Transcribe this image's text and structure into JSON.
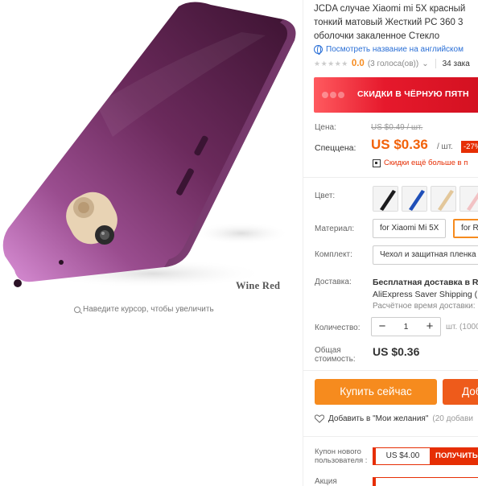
{
  "gallery": {
    "color_caption": "Wine Red",
    "zoom_hint": "Наведите курсор, чтобы увеличить"
  },
  "product": {
    "title_lines": [
      "JCDA случае Xiaomi mi 5X красный",
      "тонкий матовый Жесткий PC 360 3",
      "оболочки закаленное Стекло"
    ],
    "translate_link": "Посмотреть название на английском",
    "stars": "★★★★★",
    "rating": "0.0",
    "votes": "(3 голоса(ов))",
    "orders": "34 зака"
  },
  "banner": {
    "text": "СКИДКИ В ЧЁРНУЮ ПЯТН"
  },
  "price": {
    "old_label": "Цена:",
    "old_value": "US $0.49 / шт.",
    "promo_label": "Спеццена:",
    "current": "US $0.36",
    "unit": "/ шт.",
    "discount": "-27%",
    "qr_text": "Скидки ещё больше в п"
  },
  "options": {
    "color_label": "Цвет:",
    "colors": [
      {
        "name": "black",
        "hex": "#1b1b1d"
      },
      {
        "name": "blue",
        "hex": "#1f4fb8"
      },
      {
        "name": "gold",
        "hex": "#e3c79a"
      },
      {
        "name": "pink",
        "hex": "#f2c2c4"
      }
    ],
    "material_label": "Материал:",
    "materials": [
      "for Xiaomi Mi 5X",
      "for Re"
    ],
    "kit_label": "Комплект:",
    "kit_value": "Чехол и защитная пленка"
  },
  "shipping": {
    "label": "Доставка:",
    "title": "Бесплатная доставка в Ru",
    "method": "AliExpress Saver Shipping (",
    "eta": "Расчётное время доставки:"
  },
  "quantity": {
    "label": "Количество:",
    "minus": "−",
    "value": "1",
    "plus": "+",
    "note": "шт. (1000"
  },
  "total": {
    "label": "Общая стоимость:",
    "value": "US $0.36"
  },
  "actions": {
    "buy_now": "Купить сейчас",
    "add_to_cart": "Доб",
    "wishlist_link": "Добавить в \"Мои желания\"",
    "wishlist_count": "(20 добави"
  },
  "coupon": {
    "label": "Купон нового пользователя :",
    "amount": "US $4.00",
    "button": "ПОЛУЧИТЬ",
    "promo_label": "Акция"
  },
  "colors": {
    "accent_orange": "#f68b1e",
    "price_orange": "#f2620a",
    "promo_red": "#e62e04",
    "link_blue": "#2a6fd6",
    "case_wine": "#6b2a5c"
  }
}
